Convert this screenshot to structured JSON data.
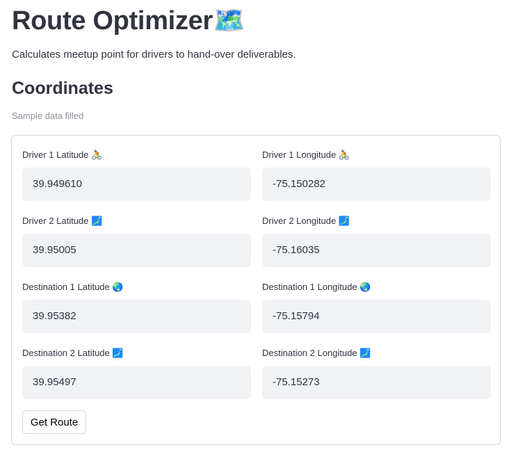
{
  "header": {
    "title": "Route Optimizer",
    "title_emoji": "🗺️",
    "subtitle": "Calculates meetup point for drivers to hand-over deliverables."
  },
  "section": {
    "title": "Coordinates",
    "caption": "Sample data filled"
  },
  "fields": [
    {
      "label": "Driver 1 Latitude",
      "emoji": "🚴",
      "value": "39.949610"
    },
    {
      "label": "Driver 1 Longitude",
      "emoji": "🚴",
      "value": "-75.150282"
    },
    {
      "label": "Driver 2 Latitude",
      "emoji": "🗾",
      "value": "39.95005"
    },
    {
      "label": "Driver 2 Longitude",
      "emoji": "🗾",
      "value": "-75.16035"
    },
    {
      "label": "Destination 1 Latitude",
      "emoji": "🌏",
      "value": "39.95382"
    },
    {
      "label": "Destination 1 Longitude",
      "emoji": "🌏",
      "value": "-75.15794"
    },
    {
      "label": "Destination 2 Latitude",
      "emoji": "🗾",
      "value": "39.95497"
    },
    {
      "label": "Destination 2 Longitude",
      "emoji": "🗾",
      "value": "-75.15273"
    }
  ],
  "form": {
    "submit_label": "Get Route"
  }
}
